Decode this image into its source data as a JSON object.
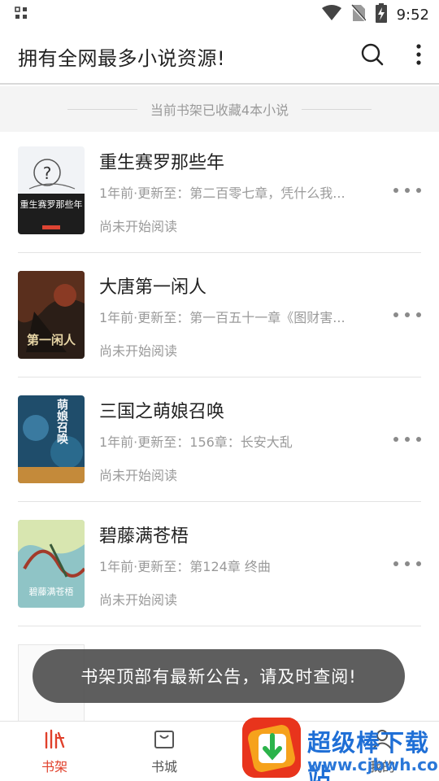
{
  "status_bar": {
    "time": "9:52",
    "icons": [
      "apps-icon",
      "wifi-icon",
      "no-sim-icon",
      "battery-charging-icon"
    ]
  },
  "header": {
    "title": "拥有全网最多小说资源!",
    "icons": [
      "search-icon",
      "more-vert-icon"
    ]
  },
  "shelf_notice": "当前书架已收藏4本小说",
  "books": [
    {
      "title": "重生赛罗那些年",
      "update": "1年前·更新至：第二百零七章，凭什么我...",
      "progress": "尚未开始阅读",
      "cover_text": "重生赛罗那些年"
    },
    {
      "title": "大唐第一闲人",
      "update": "1年前·更新至：第一百五十一章《图财害...",
      "progress": "尚未开始阅读",
      "cover_text": "第一闲人"
    },
    {
      "title": "三国之萌娘召唤",
      "update": "1年前·更新至：156章：长安大乱",
      "progress": "尚未开始阅读",
      "cover_text": "萌娘召唤"
    },
    {
      "title": "碧藤满苍梧",
      "update": "1年前·更新至：第124章 终曲",
      "progress": "尚未开始阅读",
      "cover_text": "碧藤满苍梧"
    }
  ],
  "toast": "书架顶部有最新公告，请及时查阅!",
  "bottom_nav": {
    "shelf": "书架",
    "store": "书城",
    "mine": "我的"
  },
  "watermark": {
    "title": "超级棒下载站",
    "url": "www.cjbwh.com"
  },
  "colors": {
    "accent": "#e0402b",
    "watermark_blue": "#1f6fd6"
  }
}
